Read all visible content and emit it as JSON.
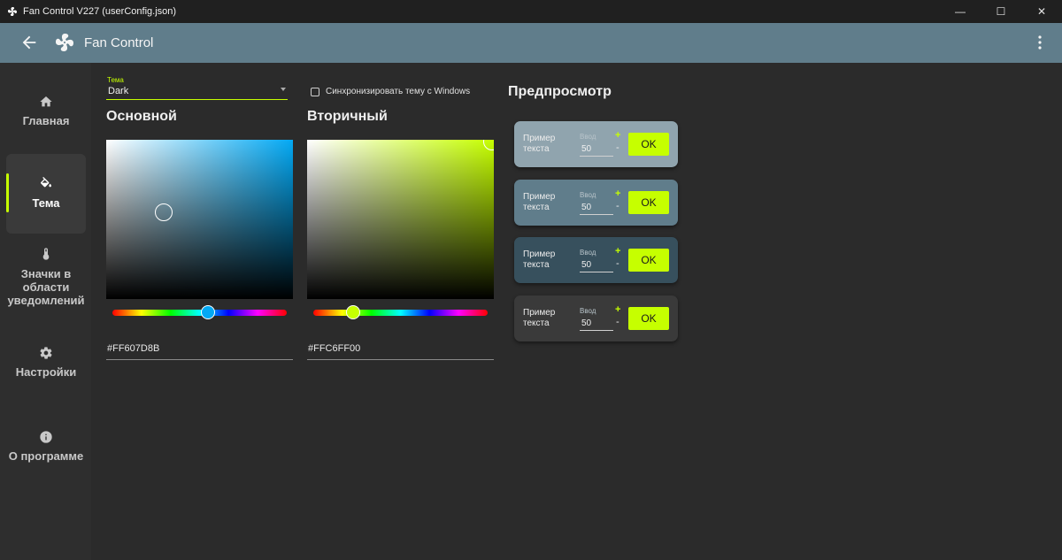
{
  "window": {
    "title": "Fan Control V227 (userConfig.json)",
    "minimize": "—",
    "maximize": "☐",
    "close": "✕"
  },
  "appbar": {
    "name": "Fan Control"
  },
  "sidebar": {
    "items": [
      {
        "label": "Главная",
        "icon": "home-icon"
      },
      {
        "label": "Тема",
        "icon": "paint-bucket-icon"
      },
      {
        "label": "Значки в области уведомлений",
        "icon": "thermometer-icon"
      },
      {
        "label": "Настройки",
        "icon": "gear-icon"
      },
      {
        "label": "О программе",
        "icon": "info-icon"
      }
    ],
    "active_index": 1
  },
  "theme": {
    "label": "Тема",
    "value": "Dark",
    "sync_label": "Синхронизировать тему с Windows",
    "sync_checked": false
  },
  "primary": {
    "title": "Основной",
    "hex": "#FF607D8B",
    "hue_color": "#03a9f4"
  },
  "secondary": {
    "title": "Вторичный",
    "hex": "#FFC6FF00",
    "hue_color": "#c6ff00"
  },
  "preview": {
    "title": "Предпросмотр",
    "cards": [
      {
        "sample": "Пример текста",
        "input_label": "Ввод",
        "value": "50",
        "plus": "+",
        "minus": "-",
        "ok": "OK",
        "bg": "#90a4ae"
      },
      {
        "sample": "Пример текста",
        "input_label": "Ввод",
        "value": "50",
        "plus": "+",
        "minus": "-",
        "ok": "OK",
        "bg": "#607d8b"
      },
      {
        "sample": "Пример текста",
        "input_label": "Ввод",
        "value": "50",
        "plus": "+",
        "minus": "-",
        "ok": "OK",
        "bg": "#37505d"
      },
      {
        "sample": "Пример текста",
        "input_label": "Ввод",
        "value": "50",
        "plus": "+",
        "minus": "-",
        "ok": "OK",
        "bg": "#3a3a3a"
      }
    ]
  },
  "colors": {
    "accent": "#c6ff00",
    "appbar": "#607d8b"
  }
}
